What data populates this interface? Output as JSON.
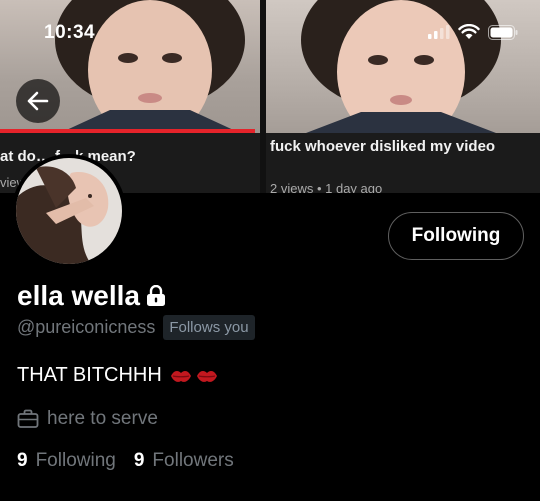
{
  "status_bar": {
    "time": "10:34"
  },
  "header": {
    "videos": [
      {
        "title": "at do… f…k mean?",
        "meta": "views • …go"
      },
      {
        "title": "fuck whoever disliked my video",
        "meta": "2 views • 1 day ago"
      }
    ]
  },
  "profile": {
    "display_name": "ella wella",
    "handle": "@pureiconicness",
    "follows_you": "Follows you",
    "bio": "THAT BITCHHH",
    "location": "here to serve",
    "following_count": "9",
    "following_label": "Following",
    "followers_count": "9",
    "followers_label": "Followers",
    "follow_button": "Following"
  },
  "colors": {
    "background": "#000000",
    "secondary_text": "#71767b",
    "progress_red": "#e5232a",
    "lips_red": "#c2181f"
  },
  "icons": [
    "back-arrow-icon",
    "lock-icon",
    "briefcase-icon",
    "kiss-mark-icon",
    "wifi-icon",
    "signal-icon",
    "battery-icon"
  ]
}
